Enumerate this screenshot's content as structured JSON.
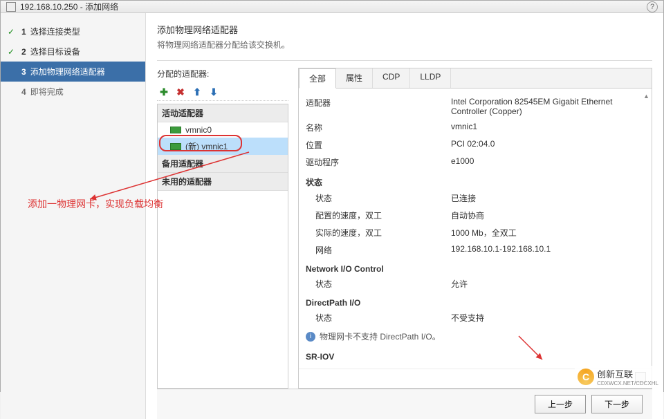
{
  "window": {
    "title": "192.168.10.250 - 添加网络"
  },
  "wizard": {
    "steps": [
      {
        "num": "1",
        "label": "选择连接类型",
        "done": true
      },
      {
        "num": "2",
        "label": "选择目标设备",
        "done": true
      },
      {
        "num": "3",
        "label": "添加物理网络适配器",
        "active": true
      },
      {
        "num": "4",
        "label": "即将完成"
      }
    ]
  },
  "main": {
    "heading": "添加物理网络适配器",
    "desc": "将物理网络适配器分配给该交换机。",
    "assigned_label": "分配的适配器:"
  },
  "adapter_groups": {
    "active": "活动适配器",
    "standby": "备用适配器",
    "unused": "未用的适配器"
  },
  "adapters": {
    "vmnic0": "vmnic0",
    "vmnic1_new": "(新) vmnic1"
  },
  "tabs": {
    "all": "全部",
    "props": "属性",
    "cdp": "CDP",
    "lldp": "LLDP"
  },
  "details": {
    "adapter_k": "适配器",
    "adapter_v": "Intel Corporation 82545EM Gigabit Ethernet Controller (Copper)",
    "name_k": "名称",
    "name_v": "vmnic1",
    "loc_k": "位置",
    "loc_v": "PCI 02:04.0",
    "drv_k": "驱动程序",
    "drv_v": "e1000",
    "status_title": "状态",
    "status_k": "状态",
    "status_v": "已连接",
    "cfg_k": "配置的速度，双工",
    "cfg_v": "自动协商",
    "act_k": "实际的速度，双工",
    "act_v": "1000 Mb，全双工",
    "net_k": "网络",
    "net_v": "192.168.10.1-192.168.10.1",
    "nioc_title": "Network I/O Control",
    "nioc_status_k": "状态",
    "nioc_status_v": "允许",
    "dpio_title": "DirectPath I/O",
    "dpio_status_k": "状态",
    "dpio_status_v": "不受支持",
    "dpio_note": "物理网卡不支持 DirectPath I/O。",
    "sriov_title": "SR-IOV"
  },
  "annotation": "添加一物理网卡，实现负载均衡",
  "buttons": {
    "prev": "上一步",
    "next": "下一步"
  },
  "watermark": {
    "brand": "创新互联",
    "sub": "CDXWCX.NET/CDCXHL"
  }
}
